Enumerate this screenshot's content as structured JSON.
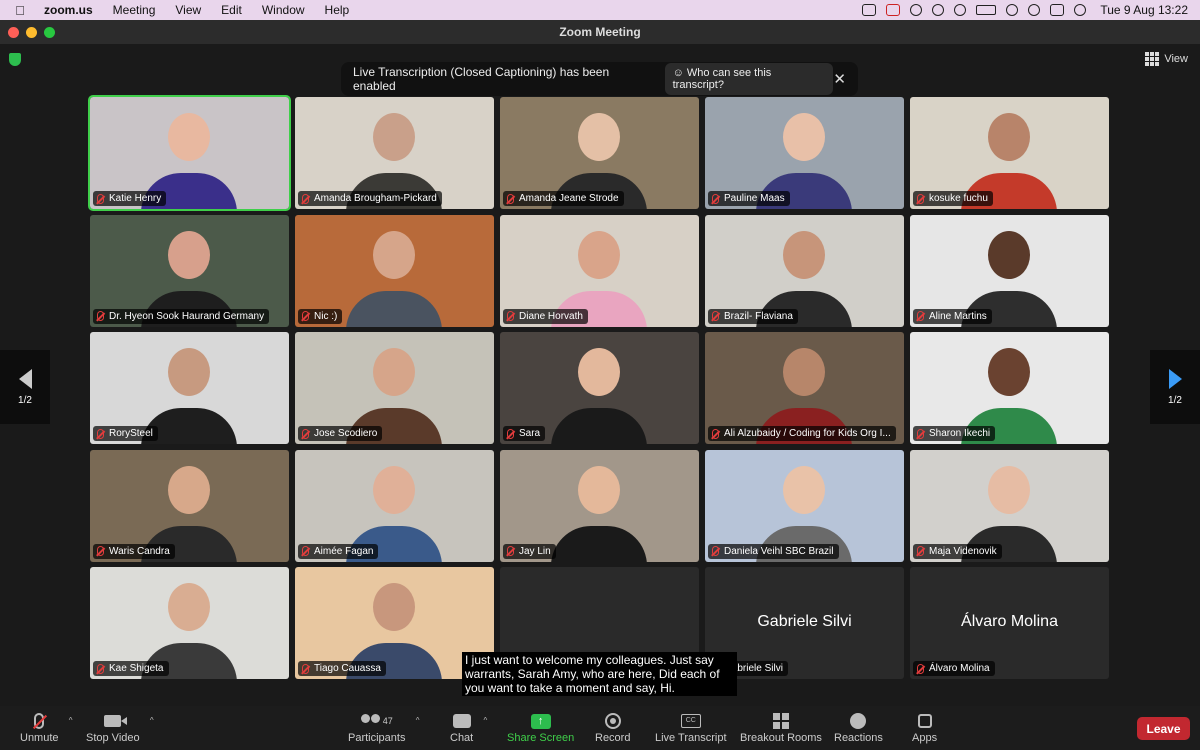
{
  "menubar": {
    "app_name": "zoom.us",
    "menus": [
      "Meeting",
      "View",
      "Edit",
      "Window",
      "Help"
    ],
    "clock": "Tue 9 Aug  13:22"
  },
  "window": {
    "title": "Zoom Meeting"
  },
  "top": {
    "view_label": "View"
  },
  "banner": {
    "message": "Live Transcription (Closed Captioning) has been enabled",
    "who_label": "Who can see this transcript?",
    "close_icon": "✕"
  },
  "participants": [
    {
      "name": "Katie Henry",
      "active": true,
      "bg": "#c9c4c7",
      "skin": "#e8b8a0",
      "shirt": "#3a2f8a"
    },
    {
      "name": "Amanda Brougham-Pickard",
      "bg": "#d8d2c8",
      "skin": "#c9a08a",
      "shirt": "#3b3a36"
    },
    {
      "name": "Amanda Jeane Strode",
      "bg": "#8a7a62",
      "skin": "#e4c0a6",
      "shirt": "#2a2a2a"
    },
    {
      "name": "Pauline Maas",
      "bg": "#9aa3ad",
      "skin": "#e8c0a8",
      "shirt": "#3a3a7a"
    },
    {
      "name": "kosuke fuchu",
      "bg": "#d9d3c7",
      "skin": "#b8846a",
      "shirt": "#c43a2a"
    },
    {
      "name": "Dr. Hyeon Sook Haurand Germany",
      "bg": "#4c5a4a",
      "skin": "#d7a08c",
      "shirt": "#1e1e1e"
    },
    {
      "name": "Nic :)",
      "bg": "#b86a3a",
      "skin": "#d6a58a",
      "shirt": "#4a5360"
    },
    {
      "name": "Diane Horvath",
      "bg": "#d7d0c6",
      "skin": "#d9a48a",
      "shirt": "#e9a5c0"
    },
    {
      "name": "Brazil- Flaviana",
      "bg": "#d1cfc9",
      "skin": "#c7957a",
      "shirt": "#2a2a2a"
    },
    {
      "name": "Aline Martins",
      "bg": "#e6e6e6",
      "skin": "#5a3a2a",
      "shirt": "#2e2e2e"
    },
    {
      "name": "RorySteel",
      "bg": "#d8d8d8",
      "skin": "#c79a80",
      "shirt": "#1e1e1e"
    },
    {
      "name": "Jose Scodiero",
      "bg": "#c5c2b8",
      "skin": "#d6a58a",
      "shirt": "#5a3a2a"
    },
    {
      "name": "Sara",
      "bg": "#4a4440",
      "skin": "#e3b89c",
      "shirt": "#1a1a1a"
    },
    {
      "name": "Ali Alzubaidy / Coding for Kids Org I...",
      "bg": "#6a5a4a",
      "skin": "#b7866a",
      "shirt": "#8a2020"
    },
    {
      "name": "Sharon Ikechi",
      "bg": "#e8e8e8",
      "skin": "#6a4230",
      "shirt": "#2f8a4a"
    },
    {
      "name": "Waris Candra",
      "bg": "#7a6a55",
      "skin": "#d7a88a",
      "shirt": "#2a2a2a"
    },
    {
      "name": "Aimée Fagan",
      "bg": "#c7c4bd",
      "skin": "#e0b098",
      "shirt": "#3a5a8a"
    },
    {
      "name": "Jay Lin",
      "bg": "#a2978a",
      "skin": "#e4b89a",
      "shirt": "#1a1a1a"
    },
    {
      "name": "Daniela Veihl SBC Brazil",
      "bg": "#b7c4d8",
      "skin": "#e9c2a8",
      "shirt": "#6a6a6a"
    },
    {
      "name": "Maja Videnovik",
      "bg": "#d2d0cc",
      "skin": "#e6bca4",
      "shirt": "#2a2a2a"
    },
    {
      "name": "Kae Shigeta",
      "bg": "#dcdcd8",
      "skin": "#d9ad92",
      "shirt": "#3a3a3a"
    },
    {
      "name": "Tiago Cauassa",
      "bg": "#e8c7a0",
      "skin": "#c8977d",
      "shirt": "#3a4a6a"
    },
    {
      "name": "",
      "bg": "#2a2a2a",
      "empty": true
    },
    {
      "name": "Gabriele Silvi",
      "bg": "#2a2a2a",
      "video_off": true
    },
    {
      "name": "Álvaro Molina",
      "bg": "#2a2a2a",
      "video_off": true
    }
  ],
  "pager": {
    "left_label": "1/2",
    "right_label": "1/2"
  },
  "caption": "I just want to welcome my colleagues. Just say warrants, Sarah Amy, who are here, Did each of you want to take a moment and say, Hi.",
  "toolbar": {
    "unmute": "Unmute",
    "stop_video": "Stop Video",
    "participants": "Participants",
    "participants_count": "47",
    "chat": "Chat",
    "share_screen": "Share Screen",
    "record": "Record",
    "live_transcript": "Live Transcript",
    "breakout_rooms": "Breakout Rooms",
    "reactions": "Reactions",
    "apps": "Apps",
    "leave": "Leave"
  }
}
